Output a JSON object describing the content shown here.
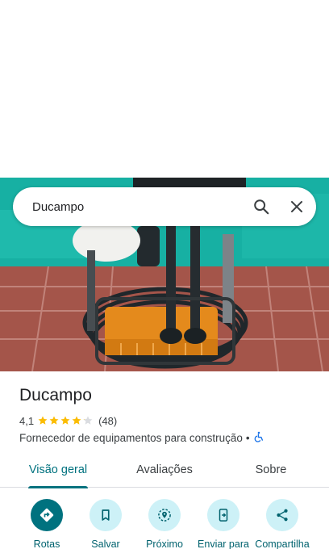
{
  "search": {
    "query": "Ducampo"
  },
  "place": {
    "name": "Ducampo",
    "rating": "4,1",
    "rating_value": 4.1,
    "stars_max": 5,
    "review_count": "(48)",
    "category": "Fornecedor de equipamentos para construção",
    "separator": "•",
    "accessibility_icon": "wheelchair-icon"
  },
  "tabs": [
    {
      "label": "Visão geral",
      "active": true
    },
    {
      "label": "Avaliações",
      "active": false
    },
    {
      "label": "Sobre",
      "active": false
    }
  ],
  "actions": [
    {
      "label": "Rotas",
      "icon": "directions-icon"
    },
    {
      "label": "Salvar",
      "icon": "bookmark-icon"
    },
    {
      "label": "Próximo",
      "icon": "nearby-icon"
    },
    {
      "label": "Enviar para",
      "icon": "send-to-phone-icon"
    },
    {
      "label": "Compartilha",
      "icon": "share-icon"
    }
  ],
  "colors": {
    "accent": "#00727f",
    "action_bg": "#cdf1f7",
    "star": "#fbbc04",
    "accessibility": "#1a73e8"
  }
}
